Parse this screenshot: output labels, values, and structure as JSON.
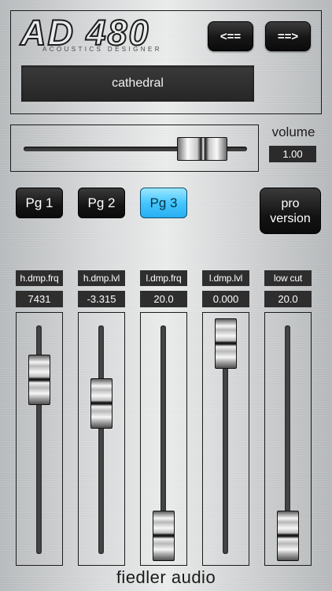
{
  "header": {
    "logo_title": "AD 480",
    "logo_subtitle": "ACOUSTICS DESIGNER",
    "prev_label": "<==",
    "next_label": "==>",
    "preset_name": "cathedral"
  },
  "volume": {
    "label": "volume",
    "value_text": "1.00",
    "level": 0.88
  },
  "pages": [
    {
      "label": "Pg 1",
      "active": false
    },
    {
      "label": "Pg 2",
      "active": false
    },
    {
      "label": "Pg 3",
      "active": true
    }
  ],
  "pro_button": {
    "line1": "pro",
    "line2": "version"
  },
  "params": [
    {
      "label": "h.dmp.frq",
      "value": "7431",
      "level": 0.81
    },
    {
      "label": "h.dmp.lvl",
      "value": "-3.315",
      "level": 0.69
    },
    {
      "label": "l.dmp.frq",
      "value": "20.0",
      "level": 0.0
    },
    {
      "label": "l.dmp.lvl",
      "value": "0.000",
      "level": 1.0
    },
    {
      "label": "low cut",
      "value": "20.0",
      "level": 0.0
    }
  ],
  "brand": "fiedler audio",
  "colors": {
    "active_page": "#45c6ff",
    "display_bg": "#2e2e2e"
  }
}
